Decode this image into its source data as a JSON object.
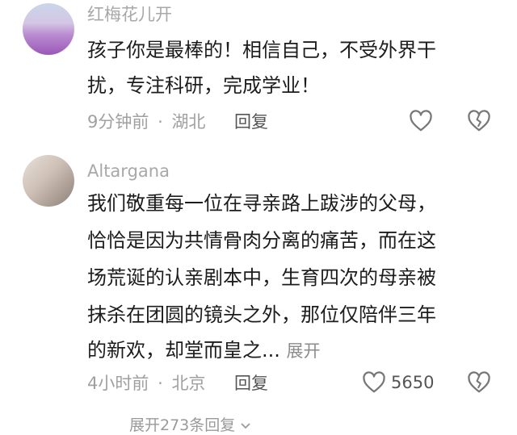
{
  "comment1": {
    "username": "红梅花儿开",
    "lines": [
      "孩子你是最棒的！相信自己，不受外界干",
      "扰，专注科研，完成学业！"
    ],
    "time": "9分钟前",
    "location": "湖北",
    "reply_label": "回复"
  },
  "comment2": {
    "username": "Altargana",
    "lines": [
      "我们敬重每一位在寻亲路上跋涉的父母，",
      "恰恰是因为共情骨肉分离的痛苦，而在这",
      "场荒诞的认亲剧本中，生育四次的母亲被",
      "抹杀在团圆的镜头之外，那位仅陪伴三年",
      "的新欢，却堂而皇之..."
    ],
    "expand_label": "展开",
    "time": "4小时前",
    "location": "北京",
    "reply_label": "回复",
    "like_count": "5650"
  },
  "more_replies": "展开273条回复",
  "meta_separator": "·",
  "icons": {
    "like": "heart-outline-icon",
    "dislike": "broken-heart-icon",
    "expand_more": "chevron-down-icon"
  },
  "colors": {
    "text": "#1c1c1c",
    "meta": "#a0a0a0",
    "icon": "#777777"
  }
}
